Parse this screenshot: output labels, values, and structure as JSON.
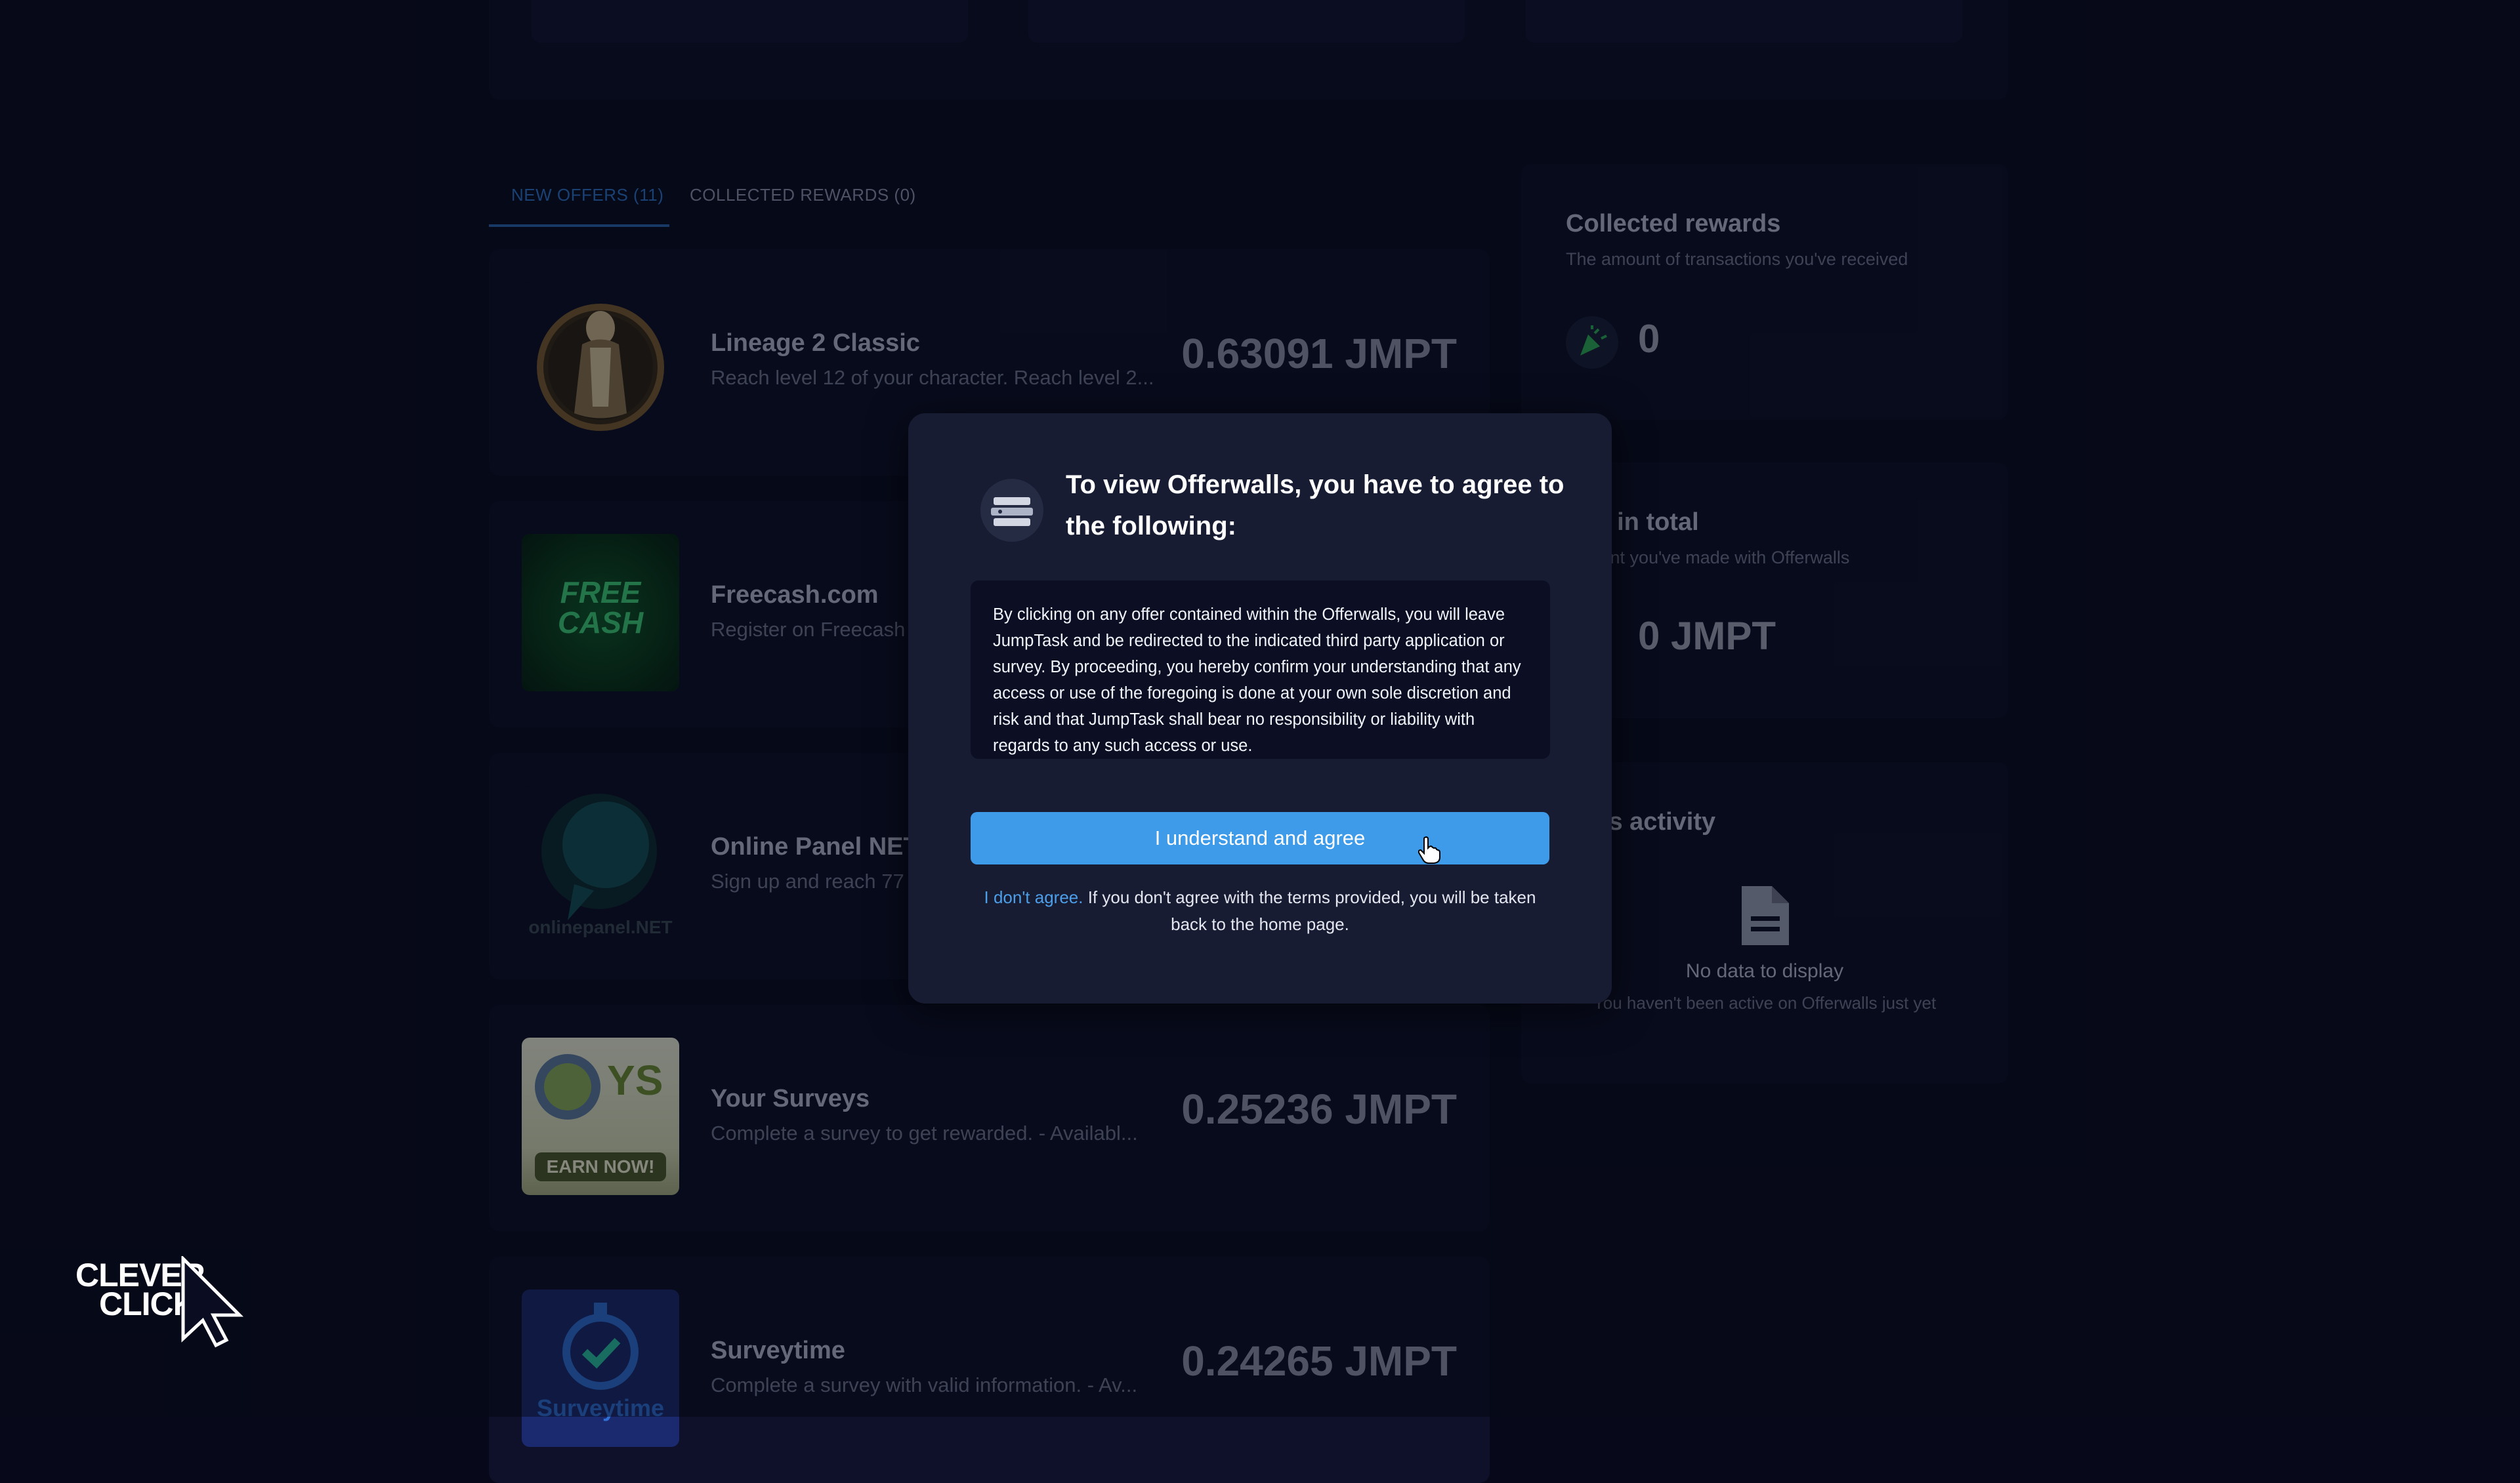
{
  "tabs": {
    "new_offers": "NEW OFFERS (11)",
    "collected_rewards": "COLLECTED REWARDS (0)"
  },
  "offers": [
    {
      "name": "Lineage 2 Classic",
      "desc": "Reach level 12 of your character. Reach level 2...",
      "reward": "0.63091 JMPT"
    },
    {
      "name": "Freecash.com",
      "desc": "Register on Freecash",
      "reward": "",
      "thumb_text": "FREE CASH"
    },
    {
      "name": "Online Panel NET",
      "desc": "Sign up and reach 77",
      "reward": "",
      "thumb_text": "onlinepanel.NET"
    },
    {
      "name": "Your Surveys",
      "desc": "Complete a survey to get rewarded. - Availabl...",
      "reward": "0.25236 JMPT",
      "thumb_text": "YS",
      "thumb_badge": "EARN NOW!"
    },
    {
      "name": "Surveytime",
      "desc": "Complete a survey with valid information. - Av...",
      "reward": "0.24265 JMPT",
      "thumb_text": "Surveytime"
    }
  ],
  "side": {
    "collected": {
      "title": "Collected rewards",
      "sub": "The amount of transactions you've received",
      "value": "0"
    },
    "earned": {
      "title": "ned in total",
      "sub": "amount you've made with Offerwalls",
      "value": "0 JMPT"
    },
    "activity": {
      "title": "days activity",
      "empty_title": "No data to display",
      "empty_sub": "You haven't been active on Offerwalls just yet"
    }
  },
  "modal": {
    "title": "To view Offerwalls, you have to agree to the following:",
    "terms": "By clicking on any offer contained within the Offerwalls, you will leave JumpTask and be redirected to the indicated third party application or survey. By proceeding, you hereby confirm your understanding that any access or use of the foregoing is done at your own sole discretion and risk and that JumpTask shall bear no responsibility or liability with regards to any such access or use.",
    "agree_button": "I understand and agree",
    "disagree_link": "I don't agree.",
    "disagree_text": " If you don't agree with the terms provided, you will be taken back to the home page."
  },
  "watermark": {
    "line1": "CLEVER",
    "line2": "CLICK"
  },
  "colors": {
    "accent": "#3d9be9",
    "tab_active": "#2f74c8",
    "modal_bg": "#181c33",
    "page_bg": "#0a0d22"
  }
}
